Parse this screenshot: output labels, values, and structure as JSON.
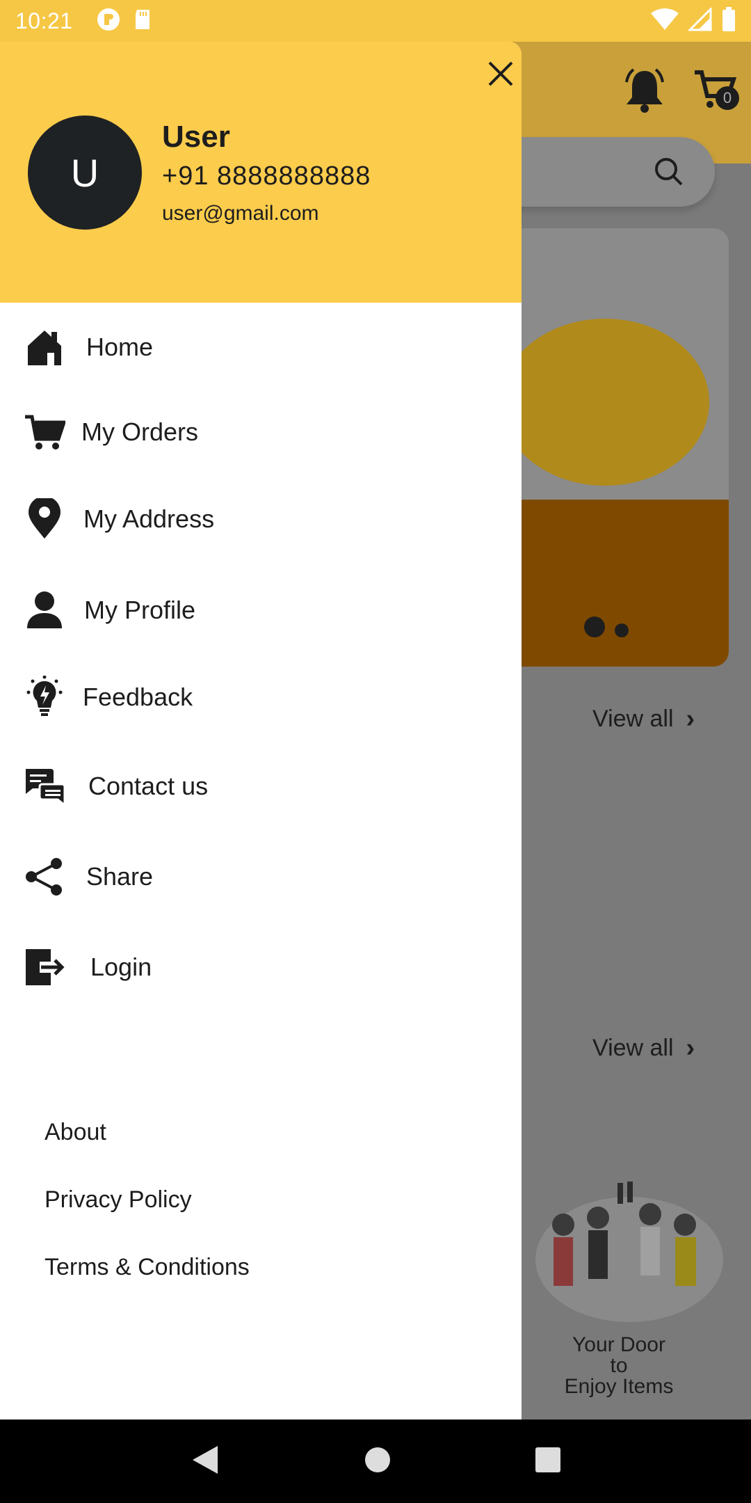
{
  "status_bar": {
    "time": "10:21"
  },
  "background_app": {
    "cart_count": "0",
    "view_all_1": "View all",
    "view_all_2": "View all",
    "promo_text_line1": "Your Door",
    "promo_text_line2": "to",
    "promo_text_line3": "Enjoy Items"
  },
  "drawer": {
    "avatar_initial": "U",
    "user_name": "User",
    "user_phone": "+91 8888888888",
    "user_email": "user@gmail.com",
    "menu": [
      {
        "label": "Home",
        "icon": "home-icon"
      },
      {
        "label": "My Orders",
        "icon": "cart-icon"
      },
      {
        "label": "My Address",
        "icon": "location-pin-icon"
      },
      {
        "label": "My Profile",
        "icon": "person-icon"
      },
      {
        "label": "Feedback",
        "icon": "lightbulb-icon"
      },
      {
        "label": "Contact us",
        "icon": "chat-icon"
      },
      {
        "label": "Share",
        "icon": "share-icon"
      },
      {
        "label": "Login",
        "icon": "login-icon"
      }
    ],
    "footer_links": [
      "About",
      "Privacy Policy",
      "Terms & Conditions"
    ]
  },
  "colors": {
    "accent": "#fccc4c",
    "status_bar": "#f6c744",
    "dark": "#1f2224"
  }
}
